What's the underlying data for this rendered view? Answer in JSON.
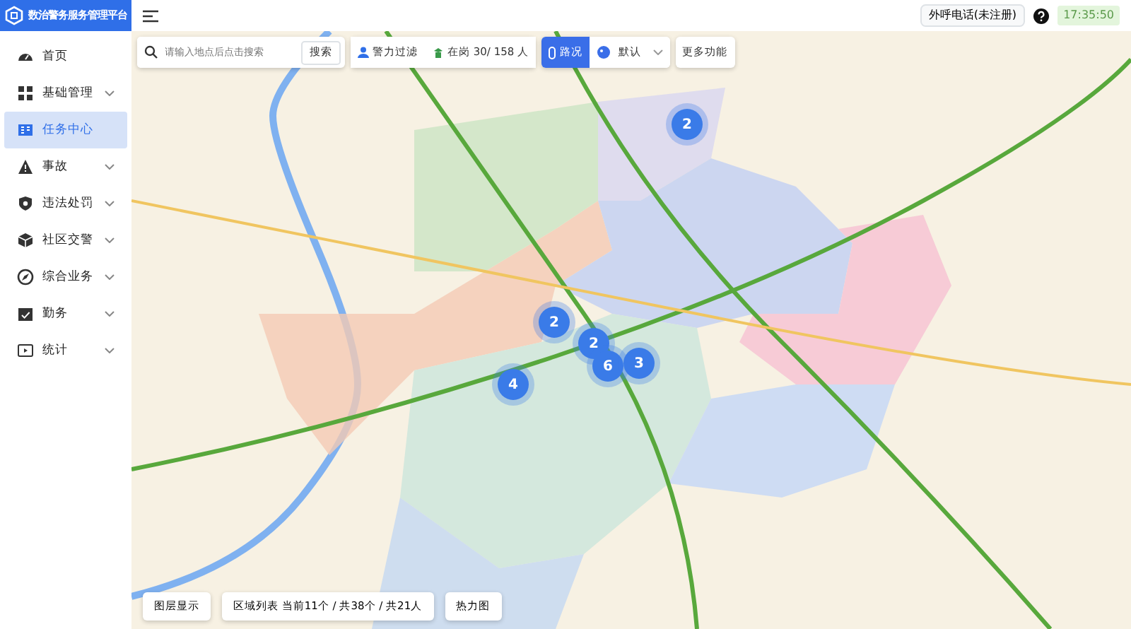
{
  "app": {
    "title": "数治警务服务管理平台"
  },
  "sidebar": {
    "items": [
      {
        "label": "首页",
        "expandable": false,
        "selected": false
      },
      {
        "label": "基础管理",
        "expandable": true,
        "selected": false
      },
      {
        "label": "任务中心",
        "expandable": false,
        "selected": true
      },
      {
        "label": "事故",
        "expandable": true,
        "selected": false
      },
      {
        "label": "违法处罚",
        "expandable": true,
        "selected": false
      },
      {
        "label": "社区交警",
        "expandable": true,
        "selected": false
      },
      {
        "label": "综合业务",
        "expandable": true,
        "selected": false
      },
      {
        "label": "勤务",
        "expandable": true,
        "selected": false
      },
      {
        "label": "统计",
        "expandable": true,
        "selected": false
      }
    ]
  },
  "header": {
    "phone_button": "外呼电话(未注册)",
    "time": "17:35:50"
  },
  "map_toolbar": {
    "search": {
      "placeholder": "请输入地点后点击搜索"
    },
    "search_button": "搜索",
    "police_filter": "警力过滤",
    "on_duty": "在岗 30/ 158 人",
    "traffic": {
      "label": "路况",
      "selected": true
    },
    "style": {
      "label": "默认"
    },
    "more": "更多功能"
  },
  "clusters": [
    {
      "count": "2"
    },
    {
      "count": "2"
    },
    {
      "count": "2"
    },
    {
      "count": "6"
    },
    {
      "count": "3"
    },
    {
      "count": "4"
    }
  ],
  "bottom_bar": {
    "layers": "图层显示",
    "area_list": "区域列表 当前11个 / 共38个 / 共21人",
    "heatmap": "热力图"
  }
}
